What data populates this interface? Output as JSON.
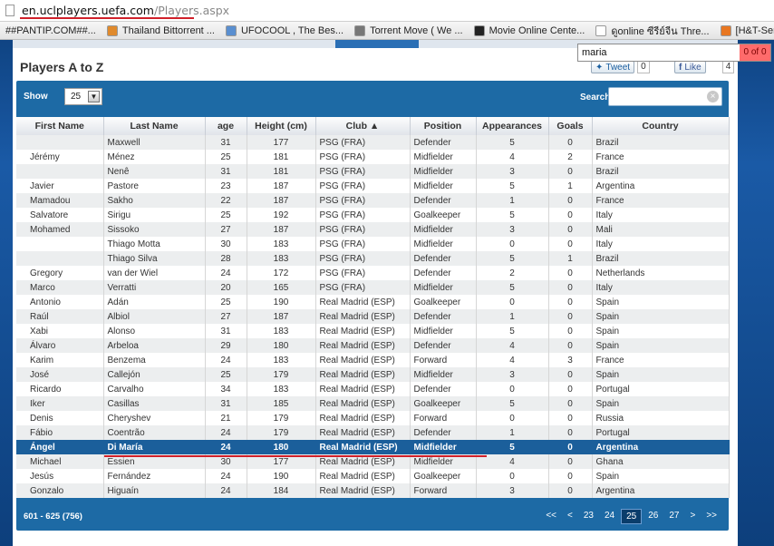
{
  "browser": {
    "url_host": "en.uclplayers.uefa.com",
    "url_path": "/Players.aspx",
    "bookmarks": [
      {
        "label": "##PANTIP.COM##...",
        "color": "#7a3fa0"
      },
      {
        "label": "Thailand Bittorrent ...",
        "color": "#e08a2c"
      },
      {
        "label": "UFOCOOL , The Bes...",
        "color": "#5a8fd0"
      },
      {
        "label": "Torrent Move ( We ...",
        "color": "#777"
      },
      {
        "label": "Movie Online Cente...",
        "color": "#222"
      },
      {
        "label": "ดูonline ซีรีย์จีน Thre...",
        "color": "#fff"
      },
      {
        "label": "[H&T-Series] Three ...",
        "color": "#e87722"
      }
    ],
    "find": {
      "query": "maria",
      "result": "0 of 0"
    }
  },
  "page": {
    "title": "Players A to Z",
    "tweet": {
      "label": "Tweet",
      "count": "0"
    },
    "like": {
      "label": "Like",
      "count": "4"
    }
  },
  "table": {
    "show_label": "Show",
    "page_size": "25",
    "search_label": "Search",
    "headers": [
      "First Name",
      "Last Name",
      "age",
      "Height (cm)",
      "Club ▲",
      "Position",
      "Appearances",
      "Goals",
      "Country"
    ],
    "rows": [
      [
        "",
        "Maxwell",
        "31",
        "177",
        "PSG (FRA)",
        "Defender",
        "5",
        "0",
        "Brazil"
      ],
      [
        "Jérémy",
        "Ménez",
        "25",
        "181",
        "PSG (FRA)",
        "Midfielder",
        "4",
        "2",
        "France"
      ],
      [
        "",
        "Nenê",
        "31",
        "181",
        "PSG (FRA)",
        "Midfielder",
        "3",
        "0",
        "Brazil"
      ],
      [
        "Javier",
        "Pastore",
        "23",
        "187",
        "PSG (FRA)",
        "Midfielder",
        "5",
        "1",
        "Argentina"
      ],
      [
        "Mamadou",
        "Sakho",
        "22",
        "187",
        "PSG (FRA)",
        "Defender",
        "1",
        "0",
        "France"
      ],
      [
        "Salvatore",
        "Sirigu",
        "25",
        "192",
        "PSG (FRA)",
        "Goalkeeper",
        "5",
        "0",
        "Italy"
      ],
      [
        "Mohamed",
        "Sissoko",
        "27",
        "187",
        "PSG (FRA)",
        "Midfielder",
        "3",
        "0",
        "Mali"
      ],
      [
        "",
        "Thiago Motta",
        "30",
        "183",
        "PSG (FRA)",
        "Midfielder",
        "0",
        "0",
        "Italy"
      ],
      [
        "",
        "Thiago Silva",
        "28",
        "183",
        "PSG (FRA)",
        "Defender",
        "5",
        "1",
        "Brazil"
      ],
      [
        "Gregory",
        "van der Wiel",
        "24",
        "172",
        "PSG (FRA)",
        "Defender",
        "2",
        "0",
        "Netherlands"
      ],
      [
        "Marco",
        "Verratti",
        "20",
        "165",
        "PSG (FRA)",
        "Midfielder",
        "5",
        "0",
        "Italy"
      ],
      [
        "Antonio",
        "Adán",
        "25",
        "190",
        "Real Madrid (ESP)",
        "Goalkeeper",
        "0",
        "0",
        "Spain"
      ],
      [
        "Raúl",
        "Albiol",
        "27",
        "187",
        "Real Madrid (ESP)",
        "Defender",
        "1",
        "0",
        "Spain"
      ],
      [
        "Xabi",
        "Alonso",
        "31",
        "183",
        "Real Madrid (ESP)",
        "Midfielder",
        "5",
        "0",
        "Spain"
      ],
      [
        "Álvaro",
        "Arbeloa",
        "29",
        "180",
        "Real Madrid (ESP)",
        "Defender",
        "4",
        "0",
        "Spain"
      ],
      [
        "Karim",
        "Benzema",
        "24",
        "183",
        "Real Madrid (ESP)",
        "Forward",
        "4",
        "3",
        "France"
      ],
      [
        "José",
        "Callejón",
        "25",
        "179",
        "Real Madrid (ESP)",
        "Midfielder",
        "3",
        "0",
        "Spain"
      ],
      [
        "Ricardo",
        "Carvalho",
        "34",
        "183",
        "Real Madrid (ESP)",
        "Defender",
        "0",
        "0",
        "Portugal"
      ],
      [
        "Iker",
        "Casillas",
        "31",
        "185",
        "Real Madrid (ESP)",
        "Goalkeeper",
        "5",
        "0",
        "Spain"
      ],
      [
        "Denis",
        "Cheryshev",
        "21",
        "179",
        "Real Madrid (ESP)",
        "Forward",
        "0",
        "0",
        "Russia"
      ],
      [
        "Fábio",
        "Coentrão",
        "24",
        "179",
        "Real Madrid (ESP)",
        "Defender",
        "1",
        "0",
        "Portugal"
      ],
      [
        "Ángel",
        "Di María",
        "24",
        "180",
        "Real Madrid (ESP)",
        "Midfielder",
        "5",
        "0",
        "Argentina"
      ],
      [
        "Michael",
        "Essien",
        "30",
        "177",
        "Real Madrid (ESP)",
        "Midfielder",
        "4",
        "0",
        "Ghana"
      ],
      [
        "Jesús",
        "Fernández",
        "24",
        "190",
        "Real Madrid (ESP)",
        "Goalkeeper",
        "0",
        "0",
        "Spain"
      ],
      [
        "Gonzalo",
        "Higuaín",
        "24",
        "184",
        "Real Madrid (ESP)",
        "Forward",
        "3",
        "0",
        "Argentina"
      ]
    ],
    "highlighted_row": 21,
    "info": "601 - 625 (756)",
    "pager": [
      "<<",
      "<",
      "23",
      "24",
      "25",
      "26",
      "27",
      ">",
      ">>"
    ],
    "current_page": "25"
  },
  "colors": {
    "panel": "#1d6aa5",
    "highlight": "#1b5f9b",
    "annotation": "#d0202a"
  }
}
